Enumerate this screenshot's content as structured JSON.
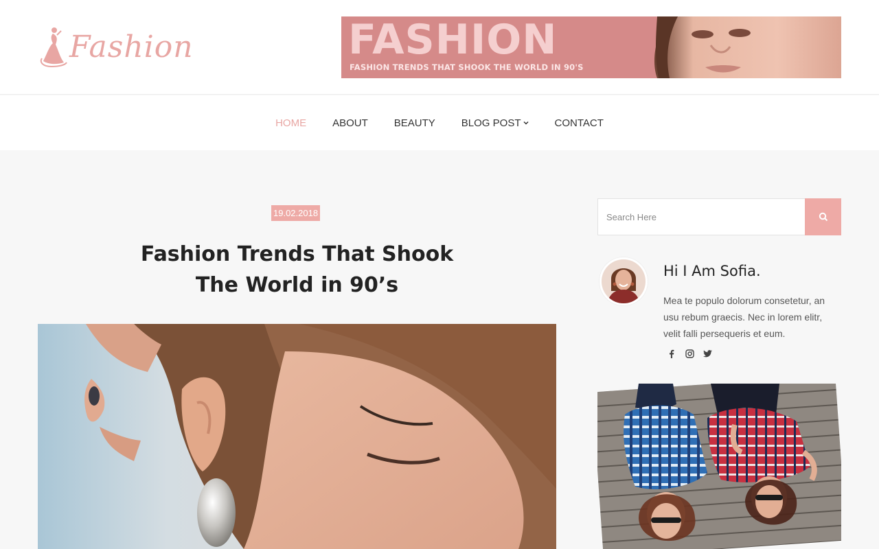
{
  "header": {
    "logo_text": "Fashion",
    "banner": {
      "title": "FASHION",
      "subtitle": "FASHION TRENDS THAT SHOOK THE WORLD IN 90'S"
    }
  },
  "nav": {
    "items": [
      {
        "label": "HOME",
        "active": true
      },
      {
        "label": "ABOUT"
      },
      {
        "label": "BEAUTY"
      },
      {
        "label": "BLOG POST"
      },
      {
        "label": "CONTACT"
      }
    ]
  },
  "post": {
    "date": "19.02.2018",
    "title_line1": "Fashion Trends That Shook",
    "title_line2": "The World in 90’s"
  },
  "sidebar": {
    "search": {
      "placeholder": "Search Here"
    },
    "about": {
      "name": "Hi I Am Sofia.",
      "text": "Mea te populo dolorum consetetur, an usu rebum graecis. Nec in lorem elitr, velit falli persequeris et eum."
    },
    "socials": [
      "facebook-icon",
      "instagram-icon",
      "twitter-icon"
    ]
  },
  "colors": {
    "accent": "#eeaaa6",
    "logo": "#e8a6a3",
    "banner_bg": "#d58a89"
  }
}
